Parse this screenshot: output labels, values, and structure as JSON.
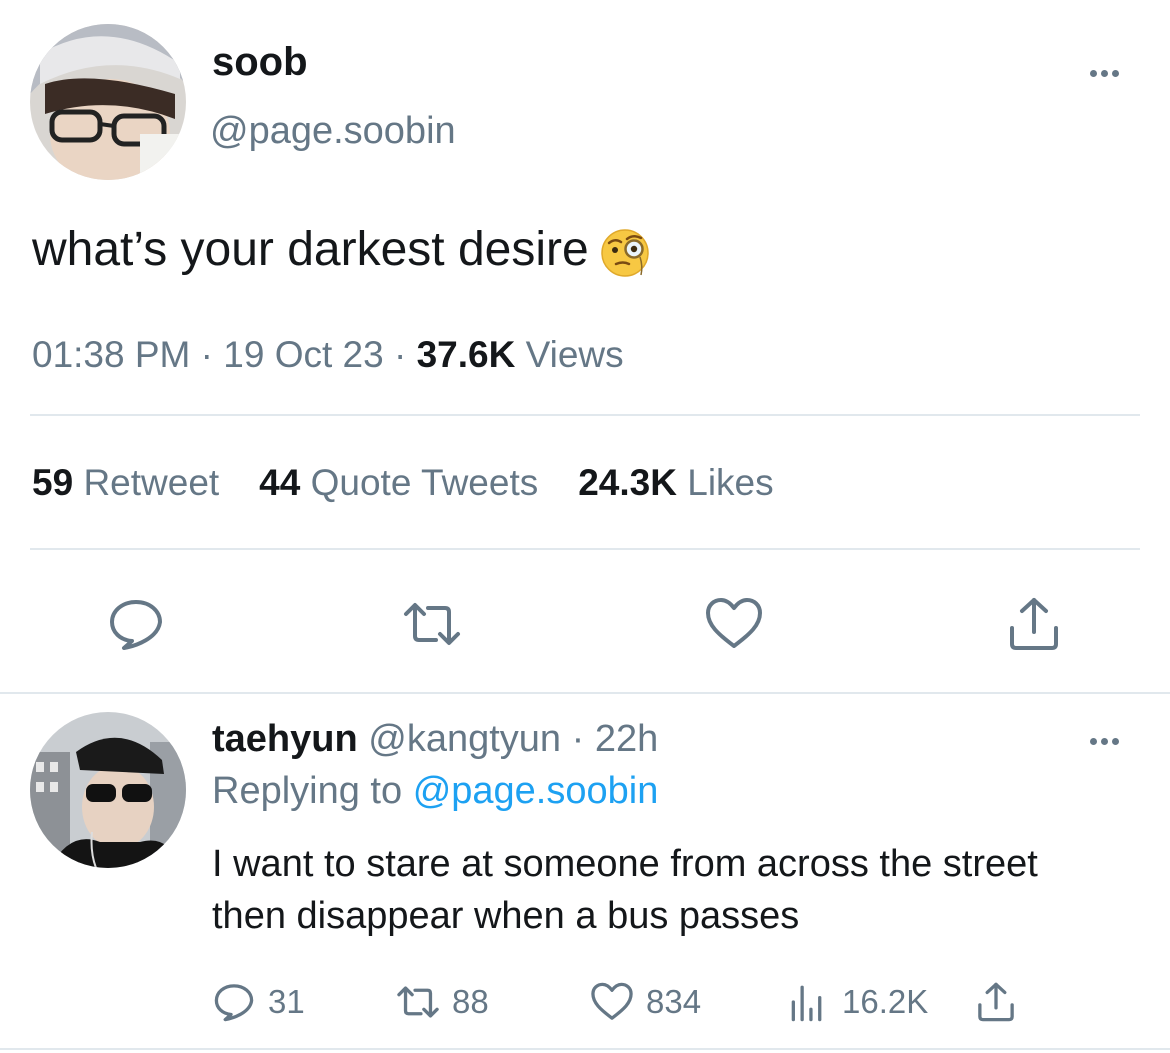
{
  "tweet": {
    "author_name": "soob",
    "author_handle": "@page.soobin",
    "text": "what’s your darkest desire",
    "emoji": "face-with-monocle",
    "time": "01:38 PM",
    "date": "19 Oct 23",
    "views_count": "37.6K",
    "views_label": "Views",
    "retweets_count": "59",
    "retweets_label": "Retweet",
    "quotes_count": "44",
    "quotes_label": "Quote Tweets",
    "likes_count": "24.3K",
    "likes_label": "Likes"
  },
  "reply": {
    "author_name": "taehyun",
    "author_handle": "@kangtyun",
    "age": "22h",
    "replying_prefix": "Replying to",
    "replying_handle": "@page.soobin",
    "text": "I want to stare at someone from across the street then disappear when a bus passes",
    "replies": "31",
    "retweets": "88",
    "likes": "834",
    "views": "16.2K"
  },
  "colors": {
    "text": "#14171a",
    "muted": "#657786",
    "link": "#1da1f2",
    "divider": "#e1e8ed"
  },
  "icons": [
    "reply-icon",
    "retweet-icon",
    "like-icon",
    "share-icon",
    "views-icon",
    "more-icon"
  ]
}
